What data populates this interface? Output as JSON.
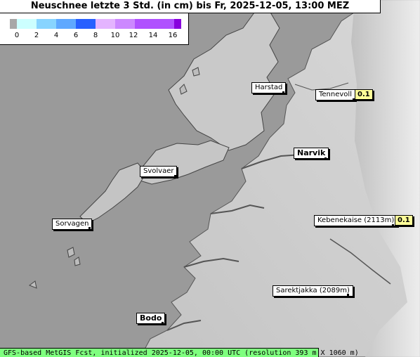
{
  "title": "Neuschnee letzte 3 Std. (in cm) bis Fr, 2025-12-05, 13:00 MEZ",
  "legend": {
    "colors": [
      "#a8a8a8",
      "#ccffff",
      "#88d4ff",
      "#5fa8ff",
      "#2860ff",
      "#e4b4ff",
      "#cc88ff",
      "#b050ff",
      "#8800dd"
    ],
    "ticks": [
      "0",
      "2",
      "4",
      "6",
      "8",
      "10",
      "12",
      "14",
      "16"
    ]
  },
  "places": [
    {
      "name": "Harstad",
      "bold": false
    },
    {
      "name": "Tennevoll",
      "bold": false
    },
    {
      "name": "Narvik",
      "bold": true
    },
    {
      "name": "Svolvaer",
      "bold": false
    },
    {
      "name": "Sorvagen",
      "bold": false
    },
    {
      "name": "Kebenekaise (2113m)",
      "bold": false
    },
    {
      "name": "Sarektjakka (2089m)",
      "bold": false
    },
    {
      "name": "Bodo",
      "bold": true
    }
  ],
  "values": [
    "0.1",
    "0.1"
  ],
  "footer": "GFS-based MetGIS Fcst, initialized 2025-12-05, 00:00 UTC  (resolution 393 m X 1060 m)"
}
